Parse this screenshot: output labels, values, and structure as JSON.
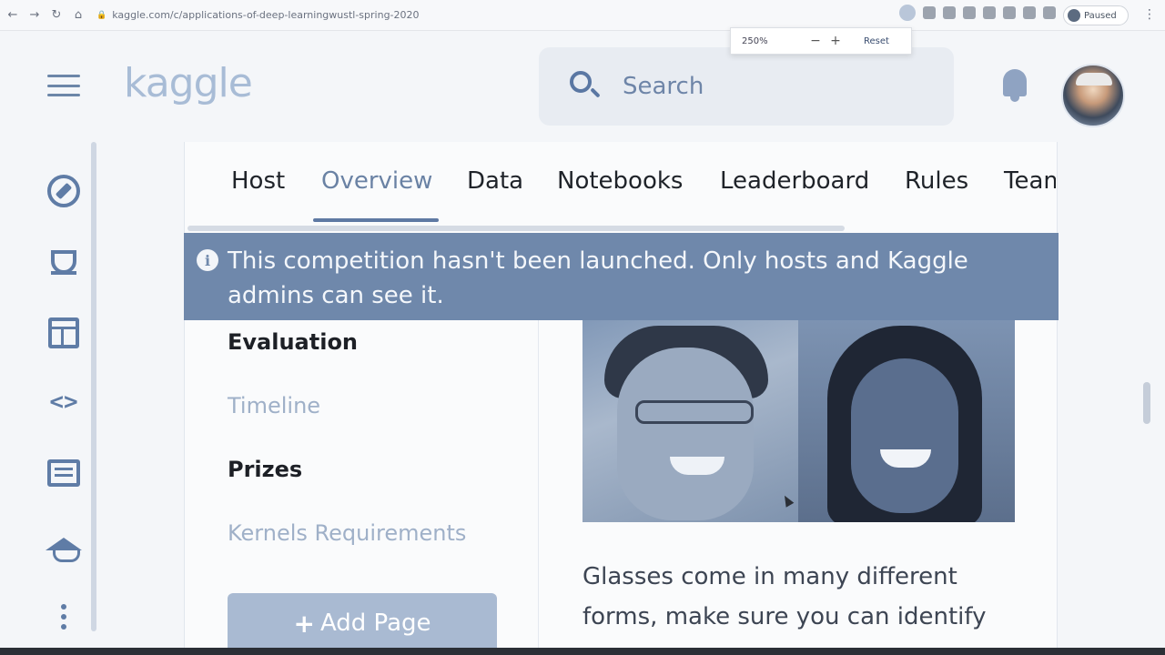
{
  "browser": {
    "url": "kaggle.com/c/applications-of-deep-learningwustl-spring-2020",
    "paused_label": "Paused",
    "zoom": {
      "percent": "250%",
      "minus": "−",
      "plus": "+",
      "reset_label": "Reset"
    }
  },
  "header": {
    "logo": "kaggle",
    "search_placeholder": "Search"
  },
  "tabs": [
    {
      "label": "Host",
      "active": false
    },
    {
      "label": "Overview",
      "active": true
    },
    {
      "label": "Data",
      "active": false
    },
    {
      "label": "Notebooks",
      "active": false
    },
    {
      "label": "Leaderboard",
      "active": false
    },
    {
      "label": "Rules",
      "active": false
    },
    {
      "label": "Team",
      "active": false
    }
  ],
  "banner": {
    "text": "This competition hasn't been launched. Only hosts and Kaggle admins can see it."
  },
  "side_nav": [
    {
      "label": "Evaluation",
      "style": "bold"
    },
    {
      "label": "Timeline",
      "style": "muted"
    },
    {
      "label": "Prizes",
      "style": "bold"
    },
    {
      "label": "Kernels Requirements",
      "style": "muted"
    }
  ],
  "add_page_label": "Add Page",
  "body_text": "Glasses come in many different forms, make sure you can identify",
  "colors": {
    "accent": "#5e79a3",
    "banner": "#6f88ab"
  },
  "icons": {
    "rail": [
      "compass-icon",
      "trophy-icon",
      "table-icon",
      "code-icon",
      "chat-icon",
      "graduation-cap-icon",
      "more-vertical-icon"
    ],
    "header": [
      "menu-icon",
      "search-icon",
      "bell-icon"
    ]
  }
}
